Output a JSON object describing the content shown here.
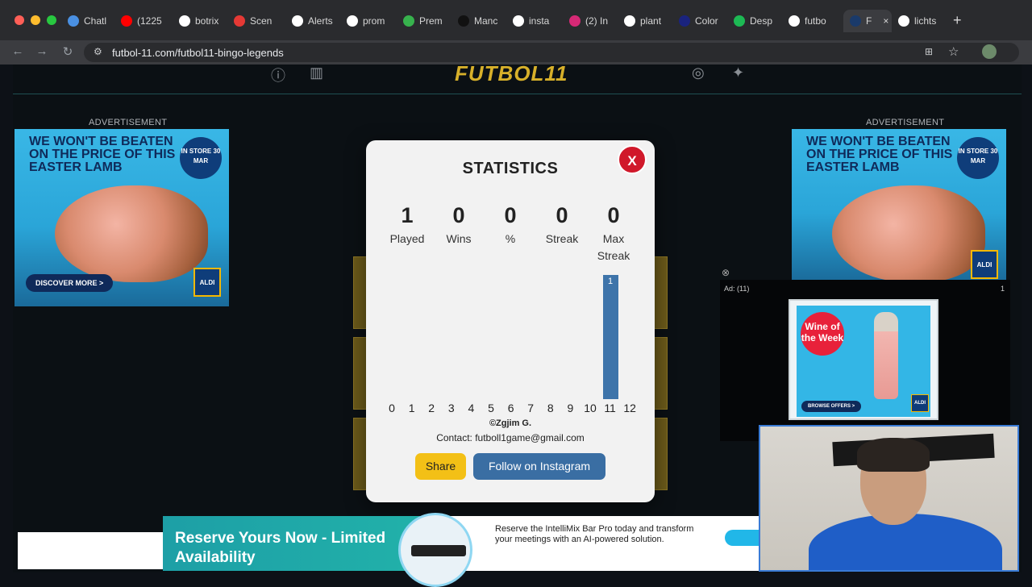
{
  "browser": {
    "tabs": [
      {
        "label": "Chatl",
        "color": "#4a90e2"
      },
      {
        "label": "(1225",
        "color": "#ff0000"
      },
      {
        "label": "botrix",
        "color": "#ffffff"
      },
      {
        "label": "Scen",
        "color": "#e53935"
      },
      {
        "label": "Alerts",
        "color": "#ffffff"
      },
      {
        "label": "prom",
        "color": "#ffffff"
      },
      {
        "label": "Prem",
        "color": "#37b24d"
      },
      {
        "label": "Manc",
        "color": "#111111"
      },
      {
        "label": "insta",
        "color": "#ffffff"
      },
      {
        "label": "(2) In",
        "color": "#d62976"
      },
      {
        "label": "plant",
        "color": "#ffffff"
      },
      {
        "label": "Color",
        "color": "#1a237e"
      },
      {
        "label": "Desp",
        "color": "#1db954"
      },
      {
        "label": "futbo",
        "color": "#ffffff"
      },
      {
        "label": "F",
        "color": "#1a3a6a"
      },
      {
        "label": "lichts",
        "color": "#ffffff"
      }
    ],
    "url": "futbol-11.com/futbol11-bingo-legends"
  },
  "site": {
    "logo": "FUTBOL11",
    "ad_label_left": "ADVERTISEMENT",
    "ad_label_right": "ADVERTISEMENT"
  },
  "easter_ad": {
    "headline": "WE WON'T BE BEATEN ON THE PRICE OF THIS EASTER LAMB",
    "badge": "IN STORE 30 MAR",
    "cta": "DISCOVER MORE >",
    "brand": "ALDI"
  },
  "modal": {
    "title": "STATISTICS",
    "close": "X",
    "stats": [
      {
        "value": "1",
        "label": "Played"
      },
      {
        "value": "0",
        "label": "Wins"
      },
      {
        "value": "0",
        "label": "%"
      },
      {
        "value": "0",
        "label": "Streak"
      },
      {
        "value": "0",
        "label": "Max Streak"
      }
    ],
    "credit": "©Zgjim G.",
    "contact": "Contact: futboll1game@gmail.com",
    "share": "Share",
    "instagram": "Follow on Instagram"
  },
  "chart_data": {
    "type": "bar",
    "categories": [
      "0",
      "1",
      "2",
      "3",
      "4",
      "5",
      "6",
      "7",
      "8",
      "9",
      "10",
      "11",
      "12"
    ],
    "values": [
      0,
      0,
      0,
      0,
      0,
      0,
      0,
      0,
      0,
      0,
      0,
      1,
      0
    ],
    "color": "#3e74aa"
  },
  "video_ad": {
    "label": "Ad: (11)",
    "counter": "1",
    "wine_badge": "Wine of the Week",
    "wine_cta": "BROWSE OFFERS >",
    "brand": "ALDI"
  },
  "banner": {
    "headline": "Reserve Yours Now - Limited Availability",
    "body": "Reserve the IntelliMix Bar Pro today and transform your meetings with an AI-powered solution."
  }
}
